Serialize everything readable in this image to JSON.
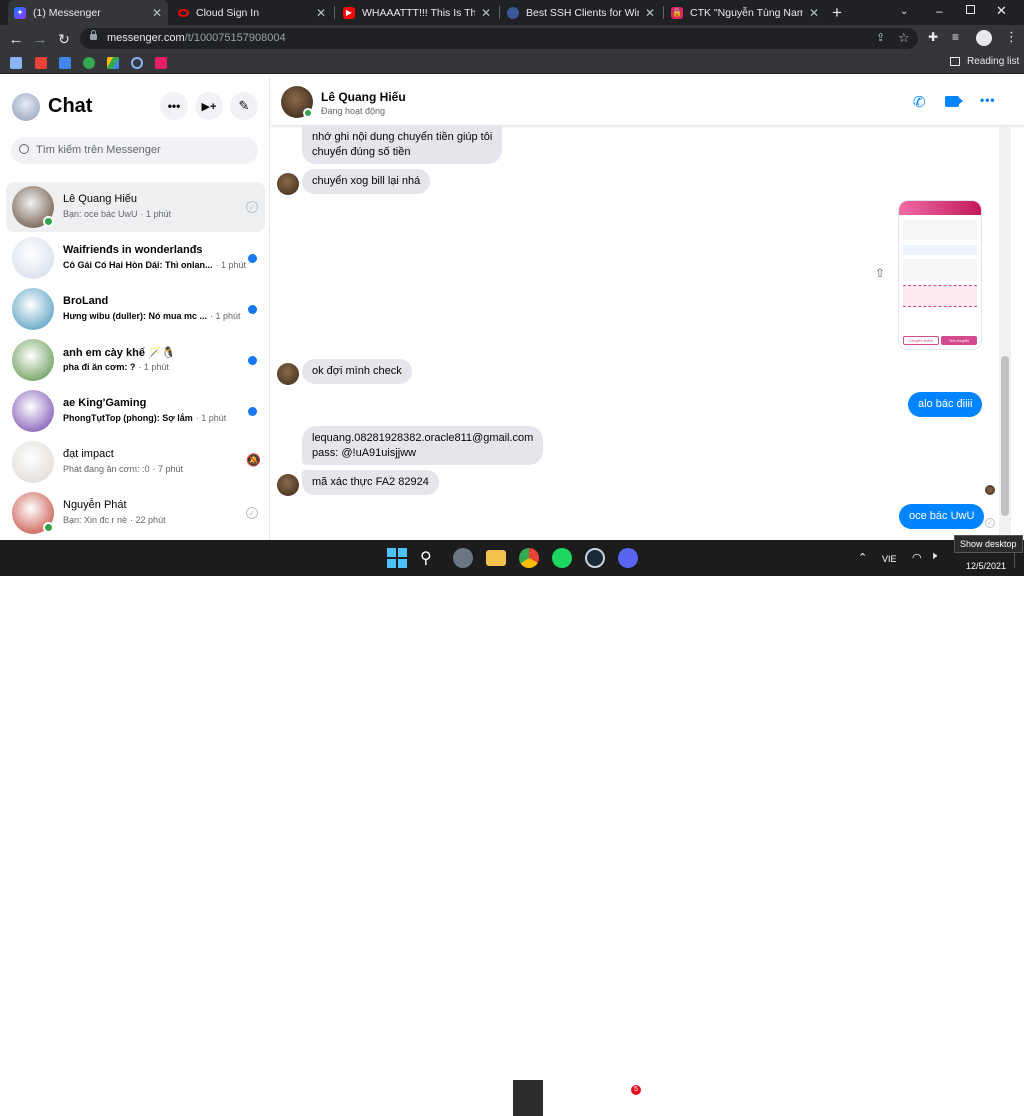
{
  "browser": {
    "tabs": [
      {
        "title": "(1) Messenger",
        "active": true
      },
      {
        "title": "Cloud Sign In",
        "active": false
      },
      {
        "title": "WHAAATTT!!! This Is The BIG",
        "active": false
      },
      {
        "title": "Best SSH Clients for Windows",
        "active": false
      },
      {
        "title": "CTK \"Nguyễn Tùng Nam\" bị",
        "active": false
      }
    ],
    "new_tab_label": "+",
    "url_host": "messenger.com",
    "url_path": "/t/100075157908004",
    "reading_list": "Reading list"
  },
  "sidebar": {
    "title": "Chat",
    "search_placeholder": "Tìm kiếm trên Messenger",
    "conversations": [
      {
        "name": "Lê Quang Hiếu",
        "preview": "Bạn: oce bác UwU",
        "time": "· 1 phút",
        "unread": false,
        "active": true,
        "online": true,
        "status": "read",
        "avatar_color": "#5a3e28"
      },
      {
        "name": "Waifrienđs in wonderlanđs",
        "preview": "Cô Gái Có Hai Hòn Dái: Thì onlan...",
        "time": "· 1 phút",
        "unread": true,
        "active": false,
        "online": false,
        "status": "dot",
        "avatar_color": "#cfd8e8"
      },
      {
        "name": "BroLand",
        "preview": "Hưng wibu (duller): Nó mua mc ...",
        "time": "· 1 phút",
        "unread": true,
        "active": false,
        "online": false,
        "status": "dot",
        "avatar_color": "#3a8fb7"
      },
      {
        "name": "anh em cày khế 🪄🐧",
        "preview": "pha đi ăn cơm: ?",
        "time": "· 1 phút",
        "unread": true,
        "active": false,
        "online": false,
        "status": "dot",
        "avatar_color": "#4f8a3a"
      },
      {
        "name": "ae King'Gaming",
        "preview": "PhongTụtTop (phong): Sợ lắm",
        "time": "· 1 phút",
        "unread": true,
        "active": false,
        "online": false,
        "status": "dot",
        "avatar_color": "#6b3aa8"
      },
      {
        "name": "đạt impact",
        "preview": "Phát đang ăn cơm: :0",
        "time": "· 7 phút",
        "unread": false,
        "active": false,
        "online": false,
        "status": "muted",
        "avatar_color": "#d9d4cf"
      },
      {
        "name": "Nguyễn Phát",
        "preview": "Bạn: Xin đc r nè",
        "time": "· 22 phút",
        "unread": false,
        "active": false,
        "online": true,
        "status": "sent",
        "avatar_color": "#c0392b"
      }
    ]
  },
  "chat": {
    "contact_name": "Lê Quang Hiếu",
    "contact_status": "Đang hoạt động",
    "messages": {
      "m1": "nhớ ghi nội dung chuyển tiền giúp tôi",
      "m1b": "chuyển đúng số tiền",
      "m2": "chuyển xog bill lại nhá",
      "m3": "ok đợi mình check",
      "m4": "alo bác điiii",
      "m5a": "lequang.08281928382.oracle811@gmail.com",
      "m5b": "pass: @!uA91uisjjww",
      "m6": "mã xác thực FA2 82924",
      "m7": "oce bác UwU"
    },
    "receipt_buttons": [
      "Chuyển thêm",
      "Trở chuyển"
    ]
  },
  "taskbar": {
    "lang": "VIE",
    "date": "12/5/2021",
    "tooltip": "Show desktop",
    "discord_badge": "5"
  },
  "colors": {
    "messenger_blue": "#0084ff",
    "fb_blue": "#1877f2",
    "bubble_gray": "#e4e6eb",
    "online_green": "#31a24c"
  }
}
